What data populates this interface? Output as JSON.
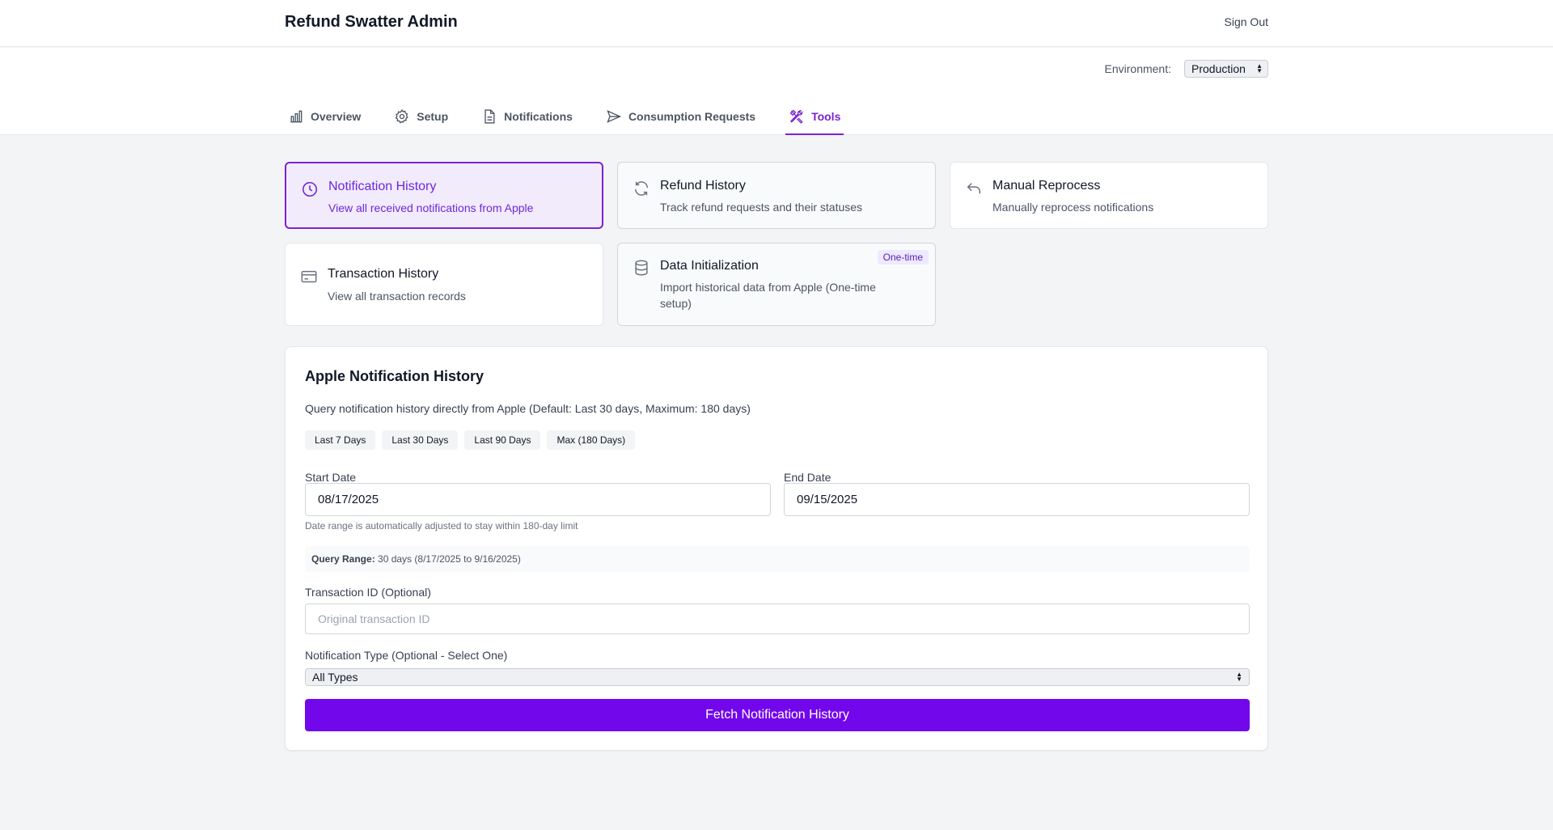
{
  "header": {
    "title": "Refund Swatter Admin",
    "sign_out": "Sign Out"
  },
  "environment": {
    "label": "Environment:",
    "selected": "Production"
  },
  "tabs": [
    {
      "label": "Overview",
      "icon": "bar-chart-icon"
    },
    {
      "label": "Setup",
      "icon": "gear-icon"
    },
    {
      "label": "Notifications",
      "icon": "document-icon"
    },
    {
      "label": "Consumption Requests",
      "icon": "send-icon"
    },
    {
      "label": "Tools",
      "icon": "tools-icon",
      "active": true
    }
  ],
  "tool_cards": [
    {
      "title": "Notification History",
      "description": "View all received notifications from Apple",
      "icon": "clock-icon",
      "selected": true
    },
    {
      "title": "Refund History",
      "description": "Track refund requests and their statuses",
      "icon": "refresh-icon"
    },
    {
      "title": "Manual Reprocess",
      "description": "Manually reprocess notifications",
      "icon": "undo-icon"
    },
    {
      "title": "Transaction History",
      "description": "View all transaction records",
      "icon": "credit-card-icon"
    },
    {
      "title": "Data Initialization",
      "description": "Import historical data from Apple (One-time setup)",
      "icon": "database-icon",
      "badge": "One-time"
    }
  ],
  "panel": {
    "title": "Apple Notification History",
    "description": "Query notification history directly from Apple (Default: Last 30 days, Maximum: 180 days)",
    "quick_ranges": [
      "Last 7 Days",
      "Last 30 Days",
      "Last 90 Days",
      "Max (180 Days)"
    ],
    "start_date_label": "Start Date",
    "start_date": "08/17/2025",
    "end_date_label": "End Date",
    "end_date": "09/15/2025",
    "date_hint": "Date range is automatically adjusted to stay within 180-day limit",
    "query_range_label": "Query Range:",
    "query_range_value": "30 days (8/17/2025 to 9/16/2025)",
    "transaction_label": "Transaction ID (Optional)",
    "transaction_placeholder": "Original transaction ID",
    "type_label": "Notification Type (Optional - Select One)",
    "type_selected": "All Types",
    "fetch_button": "Fetch Notification History"
  },
  "colors": {
    "accent": "#7e22ce",
    "button": "#7107ea",
    "selected_card_bg": "#f1ebfc"
  }
}
